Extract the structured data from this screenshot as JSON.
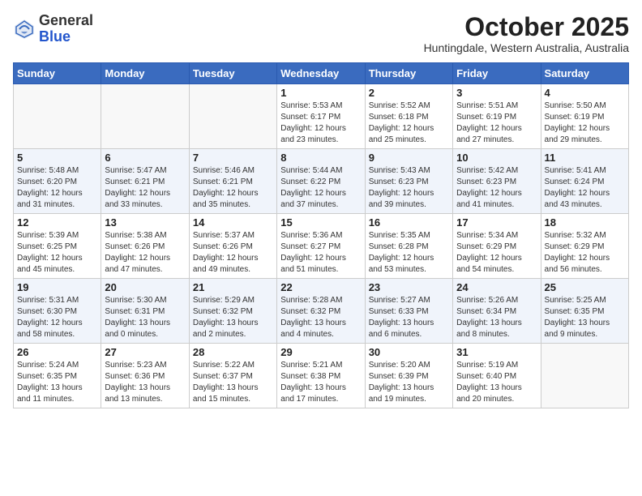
{
  "header": {
    "logo_general": "General",
    "logo_blue": "Blue",
    "title": "October 2025",
    "subtitle": "Huntingdale, Western Australia, Australia"
  },
  "weekdays": [
    "Sunday",
    "Monday",
    "Tuesday",
    "Wednesday",
    "Thursday",
    "Friday",
    "Saturday"
  ],
  "weeks": [
    [
      {
        "day": "",
        "info": ""
      },
      {
        "day": "",
        "info": ""
      },
      {
        "day": "",
        "info": ""
      },
      {
        "day": "1",
        "info": "Sunrise: 5:53 AM\nSunset: 6:17 PM\nDaylight: 12 hours\nand 23 minutes."
      },
      {
        "day": "2",
        "info": "Sunrise: 5:52 AM\nSunset: 6:18 PM\nDaylight: 12 hours\nand 25 minutes."
      },
      {
        "day": "3",
        "info": "Sunrise: 5:51 AM\nSunset: 6:19 PM\nDaylight: 12 hours\nand 27 minutes."
      },
      {
        "day": "4",
        "info": "Sunrise: 5:50 AM\nSunset: 6:19 PM\nDaylight: 12 hours\nand 29 minutes."
      }
    ],
    [
      {
        "day": "5",
        "info": "Sunrise: 5:48 AM\nSunset: 6:20 PM\nDaylight: 12 hours\nand 31 minutes."
      },
      {
        "day": "6",
        "info": "Sunrise: 5:47 AM\nSunset: 6:21 PM\nDaylight: 12 hours\nand 33 minutes."
      },
      {
        "day": "7",
        "info": "Sunrise: 5:46 AM\nSunset: 6:21 PM\nDaylight: 12 hours\nand 35 minutes."
      },
      {
        "day": "8",
        "info": "Sunrise: 5:44 AM\nSunset: 6:22 PM\nDaylight: 12 hours\nand 37 minutes."
      },
      {
        "day": "9",
        "info": "Sunrise: 5:43 AM\nSunset: 6:23 PM\nDaylight: 12 hours\nand 39 minutes."
      },
      {
        "day": "10",
        "info": "Sunrise: 5:42 AM\nSunset: 6:23 PM\nDaylight: 12 hours\nand 41 minutes."
      },
      {
        "day": "11",
        "info": "Sunrise: 5:41 AM\nSunset: 6:24 PM\nDaylight: 12 hours\nand 43 minutes."
      }
    ],
    [
      {
        "day": "12",
        "info": "Sunrise: 5:39 AM\nSunset: 6:25 PM\nDaylight: 12 hours\nand 45 minutes."
      },
      {
        "day": "13",
        "info": "Sunrise: 5:38 AM\nSunset: 6:26 PM\nDaylight: 12 hours\nand 47 minutes."
      },
      {
        "day": "14",
        "info": "Sunrise: 5:37 AM\nSunset: 6:26 PM\nDaylight: 12 hours\nand 49 minutes."
      },
      {
        "day": "15",
        "info": "Sunrise: 5:36 AM\nSunset: 6:27 PM\nDaylight: 12 hours\nand 51 minutes."
      },
      {
        "day": "16",
        "info": "Sunrise: 5:35 AM\nSunset: 6:28 PM\nDaylight: 12 hours\nand 53 minutes."
      },
      {
        "day": "17",
        "info": "Sunrise: 5:34 AM\nSunset: 6:29 PM\nDaylight: 12 hours\nand 54 minutes."
      },
      {
        "day": "18",
        "info": "Sunrise: 5:32 AM\nSunset: 6:29 PM\nDaylight: 12 hours\nand 56 minutes."
      }
    ],
    [
      {
        "day": "19",
        "info": "Sunrise: 5:31 AM\nSunset: 6:30 PM\nDaylight: 12 hours\nand 58 minutes."
      },
      {
        "day": "20",
        "info": "Sunrise: 5:30 AM\nSunset: 6:31 PM\nDaylight: 13 hours\nand 0 minutes."
      },
      {
        "day": "21",
        "info": "Sunrise: 5:29 AM\nSunset: 6:32 PM\nDaylight: 13 hours\nand 2 minutes."
      },
      {
        "day": "22",
        "info": "Sunrise: 5:28 AM\nSunset: 6:32 PM\nDaylight: 13 hours\nand 4 minutes."
      },
      {
        "day": "23",
        "info": "Sunrise: 5:27 AM\nSunset: 6:33 PM\nDaylight: 13 hours\nand 6 minutes."
      },
      {
        "day": "24",
        "info": "Sunrise: 5:26 AM\nSunset: 6:34 PM\nDaylight: 13 hours\nand 8 minutes."
      },
      {
        "day": "25",
        "info": "Sunrise: 5:25 AM\nSunset: 6:35 PM\nDaylight: 13 hours\nand 9 minutes."
      }
    ],
    [
      {
        "day": "26",
        "info": "Sunrise: 5:24 AM\nSunset: 6:35 PM\nDaylight: 13 hours\nand 11 minutes."
      },
      {
        "day": "27",
        "info": "Sunrise: 5:23 AM\nSunset: 6:36 PM\nDaylight: 13 hours\nand 13 minutes."
      },
      {
        "day": "28",
        "info": "Sunrise: 5:22 AM\nSunset: 6:37 PM\nDaylight: 13 hours\nand 15 minutes."
      },
      {
        "day": "29",
        "info": "Sunrise: 5:21 AM\nSunset: 6:38 PM\nDaylight: 13 hours\nand 17 minutes."
      },
      {
        "day": "30",
        "info": "Sunrise: 5:20 AM\nSunset: 6:39 PM\nDaylight: 13 hours\nand 19 minutes."
      },
      {
        "day": "31",
        "info": "Sunrise: 5:19 AM\nSunset: 6:40 PM\nDaylight: 13 hours\nand 20 minutes."
      },
      {
        "day": "",
        "info": ""
      }
    ]
  ]
}
